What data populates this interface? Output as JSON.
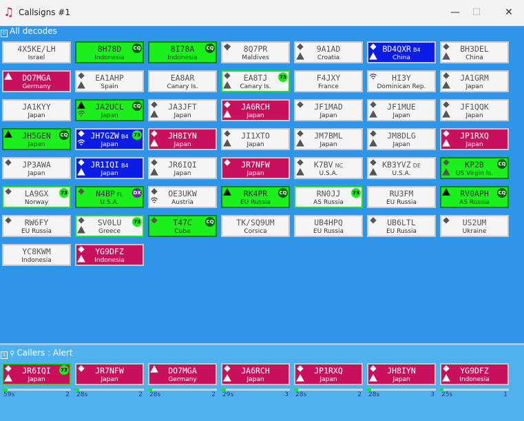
{
  "window": {
    "title": "Callsigns #1",
    "minimize": "—",
    "maximize": "☐",
    "close": "✕"
  },
  "sections": {
    "all": "All decodes",
    "callers": "Callers : Alert"
  },
  "colors": {
    "cq": "#1cf01c",
    "alert": "#c8105c",
    "dx": "#0a1ce6",
    "plain": "#f5f5f5",
    "background": "#2f95e9"
  },
  "grid": [
    {
      "cs": "4X5KE/LH",
      "ctry": "Israel",
      "type": "plain",
      "icons": "none"
    },
    {
      "cs": "8H78D",
      "ctry": "Indonesia",
      "type": "cq",
      "badge": "CQ",
      "icons": "none"
    },
    {
      "cs": "8I78A",
      "ctry": "Indonesia",
      "type": "cq",
      "badge": "CQ",
      "icons": "none"
    },
    {
      "cs": "8Q7PR",
      "ctry": "Maldives",
      "type": "plain",
      "icons": "wifi-diamond"
    },
    {
      "cs": "9A1AD",
      "ctry": "Croatia",
      "type": "plain",
      "icons": "diamond-triangle"
    },
    {
      "cs": "BD4QXR",
      "sfx": "B4",
      "ctry": "China",
      "type": "dx",
      "icons": "diamond-triangle"
    },
    {
      "cs": "BH3DEL",
      "ctry": "China",
      "type": "plain",
      "icons": "diamond-triangle"
    },
    {
      "cs": "DO7MGA",
      "ctry": "Germany",
      "type": "alert",
      "icons": "triangle"
    },
    {
      "cs": "EA1AHP",
      "ctry": "Spain",
      "type": "plain",
      "icons": "diamond-triangle"
    },
    {
      "cs": "EA8AR",
      "ctry": "Canary Is.",
      "type": "plain",
      "icons": "none"
    },
    {
      "cs": "EA8TJ",
      "ctry": "Canary Is.",
      "type": "plain",
      "hl": true,
      "badge": "73",
      "icons": "diamond-triangle"
    },
    {
      "cs": "F4JXY",
      "ctry": "France",
      "type": "plain",
      "icons": "none"
    },
    {
      "cs": "HI3Y",
      "ctry": "Dominican Rep.",
      "type": "plain",
      "icons": "wifi"
    },
    {
      "cs": "JA1GRM",
      "ctry": "Japan",
      "type": "plain",
      "icons": "diamond-triangle"
    },
    {
      "cs": "JA1KYY",
      "ctry": "Japan",
      "type": "plain",
      "icons": "none"
    },
    {
      "cs": "JA2UCL",
      "ctry": "Japan",
      "type": "cq",
      "badge": "CQ",
      "icons": "triangle-wifi"
    },
    {
      "cs": "JA3JFT",
      "ctry": "Japan",
      "type": "plain",
      "icons": "diamond-triangle"
    },
    {
      "cs": "JA6RCH",
      "ctry": "Japan",
      "type": "alert",
      "icons": "diamond-triangle"
    },
    {
      "cs": "JF1MAD",
      "ctry": "Japan",
      "type": "plain",
      "icons": "diamond"
    },
    {
      "cs": "JF1MUE",
      "ctry": "Japan",
      "type": "plain",
      "icons": "diamond-triangle"
    },
    {
      "cs": "JF1QQK",
      "ctry": "Japan",
      "type": "plain",
      "icons": "diamond-triangle"
    },
    {
      "cs": "JH5GEN",
      "ctry": "Japan",
      "type": "cq",
      "badge": "CQ",
      "icons": "triangle"
    },
    {
      "cs": "JH7GZW",
      "sfx": "B4",
      "ctry": "Japan",
      "type": "dx",
      "badge": "73",
      "icons": "diamond-wifi"
    },
    {
      "cs": "JH8IYN",
      "ctry": "Japan",
      "type": "alert",
      "icons": "diamond-triangle"
    },
    {
      "cs": "JI1XTO",
      "ctry": "Japan",
      "type": "plain",
      "icons": "diamond-triangle"
    },
    {
      "cs": "JM7BML",
      "ctry": "Japan",
      "type": "plain",
      "icons": "diamond-triangle"
    },
    {
      "cs": "JM8DLG",
      "ctry": "Japan",
      "type": "plain",
      "icons": "diamond-triangle"
    },
    {
      "cs": "JP1RXQ",
      "ctry": "Japan",
      "type": "alert",
      "icons": "diamond-triangle"
    },
    {
      "cs": "JP3AWA",
      "ctry": "Japan",
      "type": "plain",
      "icons": "diamond"
    },
    {
      "cs": "JR1IQI",
      "sfx": "B4",
      "ctry": "Japan",
      "type": "dx",
      "icons": "diamond-triangle"
    },
    {
      "cs": "JR6IQI",
      "ctry": "Japan",
      "type": "plain",
      "icons": "diamond-triangle"
    },
    {
      "cs": "JR7NFW",
      "ctry": "Japan",
      "type": "alert",
      "icons": "diamond"
    },
    {
      "cs": "K7BV",
      "sfx": "NC",
      "ctry": "U.S.A.",
      "type": "plain",
      "icons": "diamond-triangle"
    },
    {
      "cs": "KB3YVZ",
      "sfx": "DE",
      "ctry": "U.S.A.",
      "type": "plain",
      "icons": "diamond-triangle"
    },
    {
      "cs": "KP2B",
      "ctry": "US Virgin Is.",
      "type": "cq",
      "badge": "CQ",
      "icons": "diamond-triangle"
    },
    {
      "cs": "LA9GX",
      "ctry": "Norway",
      "type": "plain",
      "hl": true,
      "badge": "73",
      "icons": "diamond"
    },
    {
      "cs": "N4BP",
      "sfx": "FL",
      "ctry": "U.S.A.",
      "type": "cq",
      "badge": "DX",
      "icons": "diamond"
    },
    {
      "cs": "OE3UKW",
      "ctry": "Austria",
      "type": "plain",
      "icons": "diamond-wifi"
    },
    {
      "cs": "RK4PR",
      "ctry": "EU Russia",
      "type": "cq",
      "badge": "CQ",
      "icons": "triangle"
    },
    {
      "cs": "RN0JJ",
      "ctry": "AS Russia",
      "type": "plain",
      "hl": true,
      "badge": "73",
      "icons": "none"
    },
    {
      "cs": "RU3FM",
      "ctry": "EU Russia",
      "type": "plain",
      "icons": "none"
    },
    {
      "cs": "RV0APH",
      "ctry": "AS Russia",
      "type": "cq",
      "badge": "CQ",
      "icons": "triangle"
    },
    {
      "cs": "RW6FY",
      "ctry": "EU Russia",
      "type": "plain",
      "icons": "diamond"
    },
    {
      "cs": "SV0LU",
      "ctry": "Greece",
      "type": "plain",
      "hl": true,
      "badge": "73",
      "icons": "diamond-triangle"
    },
    {
      "cs": "T47C",
      "ctry": "Cuba",
      "type": "cq",
      "badge": "CQ",
      "icons": "diamond"
    },
    {
      "cs": "TK/SQ9UM",
      "ctry": "Corsica",
      "type": "plain",
      "icons": "none"
    },
    {
      "cs": "UB4HPQ",
      "ctry": "EU Russia",
      "type": "plain",
      "icons": "none"
    },
    {
      "cs": "UB6LTL",
      "ctry": "EU Russia",
      "type": "plain",
      "icons": "diamond"
    },
    {
      "cs": "US2UM",
      "ctry": "Ukraine",
      "type": "plain",
      "icons": "diamond"
    },
    {
      "cs": "YC8KWM",
      "ctry": "Indonesia",
      "type": "plain",
      "icons": "none"
    },
    {
      "cs": "YG9DFZ",
      "ctry": "Indonesia",
      "type": "alert",
      "icons": "diamond-triangle"
    }
  ],
  "callers": [
    {
      "cs": "JR6IQI",
      "ctry": "Japan",
      "type": "alert",
      "hl": true,
      "badge": "73",
      "icons": "diamond-triangle",
      "time": "59s",
      "count": "2",
      "progress": 0.08
    },
    {
      "cs": "JR7NFW",
      "ctry": "Japan",
      "type": "alert",
      "icons": "diamond",
      "time": "28s",
      "count": "2",
      "progress": 0.06
    },
    {
      "cs": "DO7MGA",
      "ctry": "Germany",
      "type": "alert",
      "icons": "triangle",
      "time": "28s",
      "count": "2",
      "progress": 0.06
    },
    {
      "cs": "JA6RCH",
      "ctry": "Japan",
      "type": "alert",
      "icons": "diamond-triangle",
      "time": "29s",
      "count": "3",
      "progress": 0.07
    },
    {
      "cs": "JP1RXQ",
      "ctry": "Japan",
      "type": "alert",
      "icons": "diamond-triangle",
      "time": "28s",
      "count": "2",
      "progress": 0.06
    },
    {
      "cs": "JH8IYN",
      "ctry": "Japan",
      "type": "alert",
      "icons": "diamond-triangle",
      "time": "28s",
      "count": "3",
      "progress": 0.06
    },
    {
      "cs": "YG9DFZ",
      "ctry": "Indonesia",
      "type": "alert",
      "icons": "diamond-triangle",
      "time": "25s",
      "count": "1",
      "progress": 0.05
    }
  ]
}
